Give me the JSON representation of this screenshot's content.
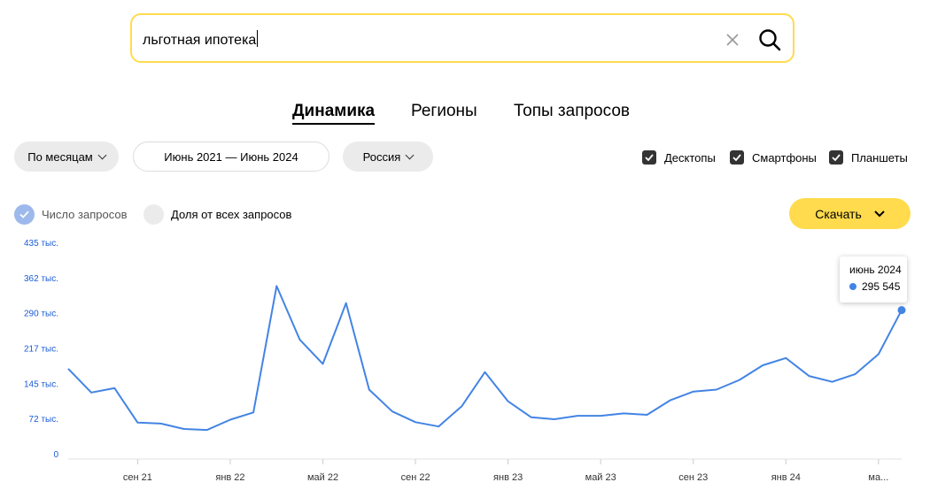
{
  "search": {
    "value": "льготная ипотека"
  },
  "tabs": [
    {
      "label": "Динамика",
      "active": true
    },
    {
      "label": "Регионы",
      "active": false
    },
    {
      "label": "Топы запросов",
      "active": false
    }
  ],
  "filters": {
    "period_mode": "По месяцам",
    "date_range": "Июнь 2021 — Июнь 2024",
    "region": "Россия"
  },
  "devices": [
    {
      "label": "Десктопы",
      "checked": true
    },
    {
      "label": "Смартфоны",
      "checked": true
    },
    {
      "label": "Планшеты",
      "checked": true
    }
  ],
  "metrics": {
    "count": {
      "label": "Число запросов",
      "selected": true
    },
    "share": {
      "label": "Доля от всех запросов",
      "selected": false
    }
  },
  "download_label": "Скачать",
  "colors": {
    "accent": "#ffdb4d",
    "line": "#4384e4",
    "axis_text": "#1a5bd6"
  },
  "tooltip": {
    "period": "июнь 2024",
    "value": "295 545"
  },
  "chart_data": {
    "type": "line",
    "x": [
      "2021-06",
      "2021-07",
      "2021-08",
      "2021-09",
      "2021-10",
      "2021-11",
      "2021-12",
      "2022-01",
      "2022-02",
      "2022-03",
      "2022-04",
      "2022-05",
      "2022-06",
      "2022-07",
      "2022-08",
      "2022-09",
      "2022-10",
      "2022-11",
      "2022-12",
      "2023-01",
      "2023-02",
      "2023-03",
      "2023-04",
      "2023-05",
      "2023-06",
      "2023-07",
      "2023-08",
      "2023-09",
      "2023-10",
      "2023-11",
      "2023-12",
      "2024-01",
      "2024-02",
      "2024-03",
      "2024-04",
      "2024-05",
      "2024-06"
    ],
    "series": [
      {
        "values": [
          175000,
          126000,
          135000,
          64000,
          62000,
          51000,
          49000,
          70000,
          85000,
          345000,
          235000,
          185000,
          310000,
          132000,
          87000,
          65000,
          56000,
          98000,
          168000,
          108000,
          75000,
          71000,
          78000,
          78000,
          83000,
          80000,
          110000,
          128000,
          132000,
          152000,
          182000,
          197000,
          160000,
          148000,
          164000,
          205000,
          295545
        ]
      }
    ],
    "y_ticks": [
      "0",
      "72 тыс.",
      "145 тыс.",
      "217 тыс.",
      "290 тыс.",
      "362 тыс.",
      "435 тыс."
    ],
    "y_tick_values": [
      0,
      72500,
      145000,
      217500,
      290000,
      362500,
      435000
    ],
    "ylim": [
      0,
      435000
    ],
    "x_tick_labels": [
      {
        "label": "сен 21",
        "x": "2021-09"
      },
      {
        "label": "янв 22",
        "x": "2022-01"
      },
      {
        "label": "май 22",
        "x": "2022-05"
      },
      {
        "label": "сен 22",
        "x": "2022-09"
      },
      {
        "label": "янв 23",
        "x": "2023-01"
      },
      {
        "label": "май 23",
        "x": "2023-05"
      },
      {
        "label": "сен 23",
        "x": "2023-09"
      },
      {
        "label": "янв 24",
        "x": "2024-01"
      },
      {
        "label": "ма...",
        "x": "2024-05"
      }
    ],
    "grid": false,
    "legend": "none"
  }
}
